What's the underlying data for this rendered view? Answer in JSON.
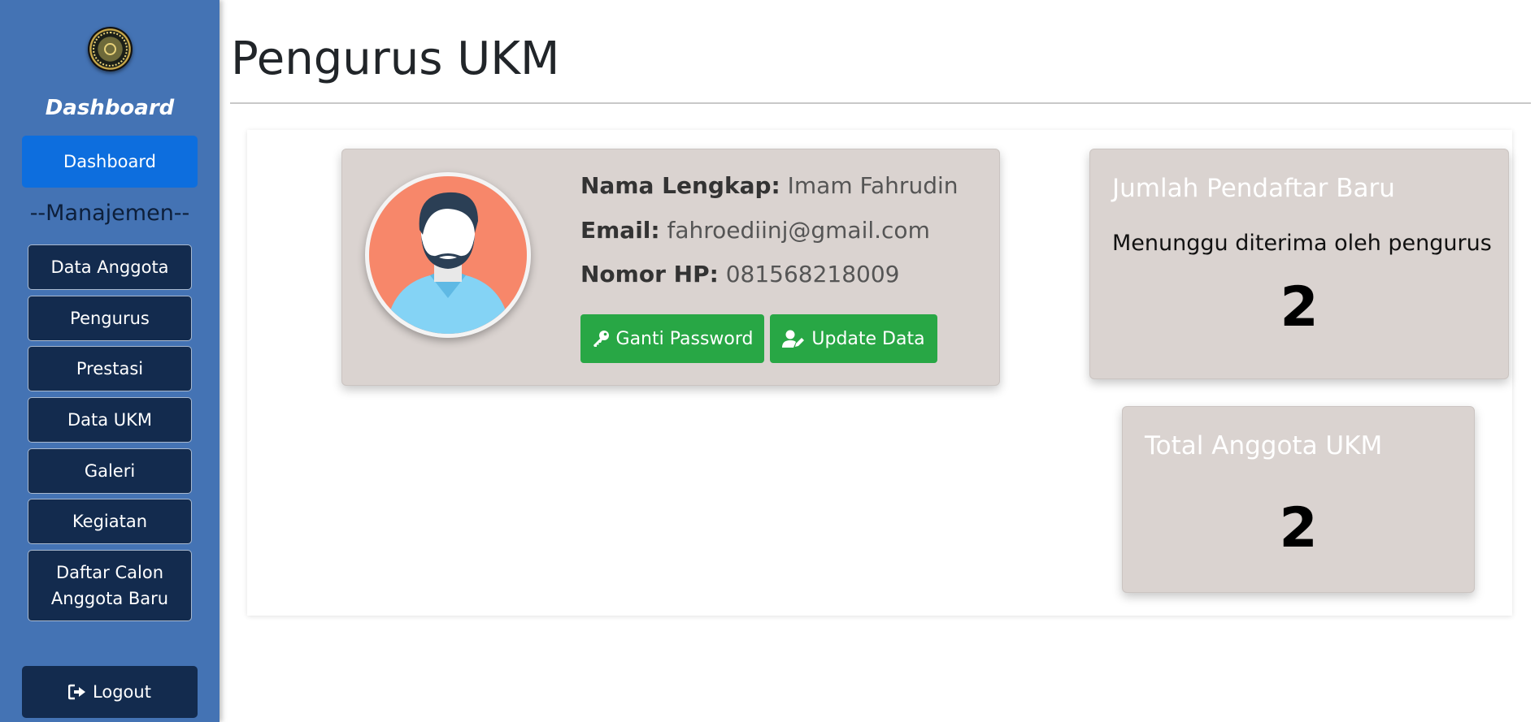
{
  "sidebar": {
    "title": "Dashboard",
    "active_item": "Dashboard",
    "section_label": "--Manajemen--",
    "items": [
      {
        "label": "Data Anggota"
      },
      {
        "label": "Pengurus"
      },
      {
        "label": "Prestasi"
      },
      {
        "label": "Data UKM"
      },
      {
        "label": "Galeri"
      },
      {
        "label": "Kegiatan"
      },
      {
        "label": "Daftar Calon Anggota Baru"
      }
    ],
    "logout_label": "Logout",
    "logout_icon": "sign-out-icon",
    "color": "#4473b4"
  },
  "page": {
    "title": "Pengurus UKM"
  },
  "profile": {
    "name_label": "Nama Lengkap:",
    "name_value": "Imam Fahrudin",
    "email_label": "Email:",
    "email_value": "fahroediinj@gmail.com",
    "phone_label": "Nomor HP:",
    "phone_value": "081568218009",
    "change_password_label": "Ganti Password",
    "change_password_icon": "key-icon",
    "update_label": "Update Data",
    "update_icon": "user-edit-icon",
    "button_color": "#28a745"
  },
  "stats": {
    "new_applicants": {
      "title": "Jumlah Pendaftar Baru",
      "subtitle": "Menunggu diterima oleh pengurus",
      "value": "2"
    },
    "total_members": {
      "title": "Total Anggota UKM",
      "value": "2"
    }
  }
}
